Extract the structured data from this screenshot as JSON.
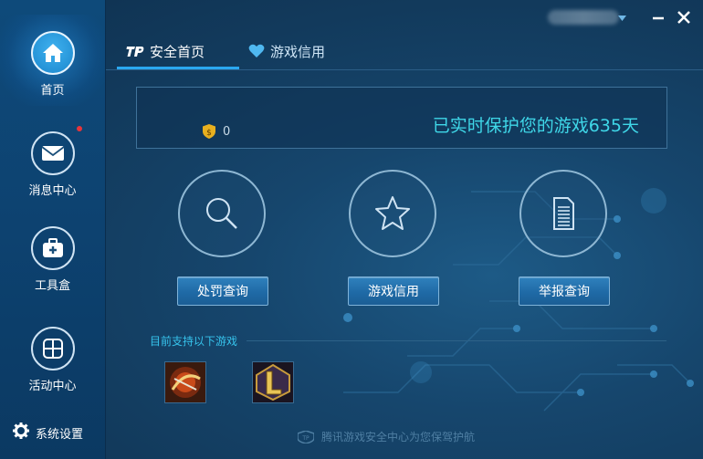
{
  "sidebar": {
    "items": [
      {
        "label": "首页",
        "icon": "home-icon"
      },
      {
        "label": "消息中心",
        "icon": "mail-icon"
      },
      {
        "label": "工具盒",
        "icon": "toolbox-icon"
      },
      {
        "label": "活动中心",
        "icon": "grid-icon"
      }
    ],
    "settings_label": "系统设置"
  },
  "tabs": [
    {
      "label": "安全首页",
      "logo": "TP"
    },
    {
      "label": "游戏信用",
      "icon": "heart-icon"
    }
  ],
  "banner": {
    "protect_text": "已实时保护您的游戏635天",
    "coin_value": "0"
  },
  "features": [
    {
      "icon": "search-icon",
      "button": "处罚查询"
    },
    {
      "icon": "star-icon",
      "button": "游戏信用"
    },
    {
      "icon": "document-icon",
      "button": "举报查询"
    }
  ],
  "support": {
    "label": "目前支持以下游戏",
    "games": [
      "dnf-game-icon",
      "lol-game-icon"
    ]
  },
  "footer": {
    "logo": "TP",
    "text": "腾讯游戏安全中心为您保驾护航"
  },
  "colors": {
    "accent": "#2aa8f0",
    "highlight_text": "#3fd7e8",
    "notification": "#e8343a"
  }
}
